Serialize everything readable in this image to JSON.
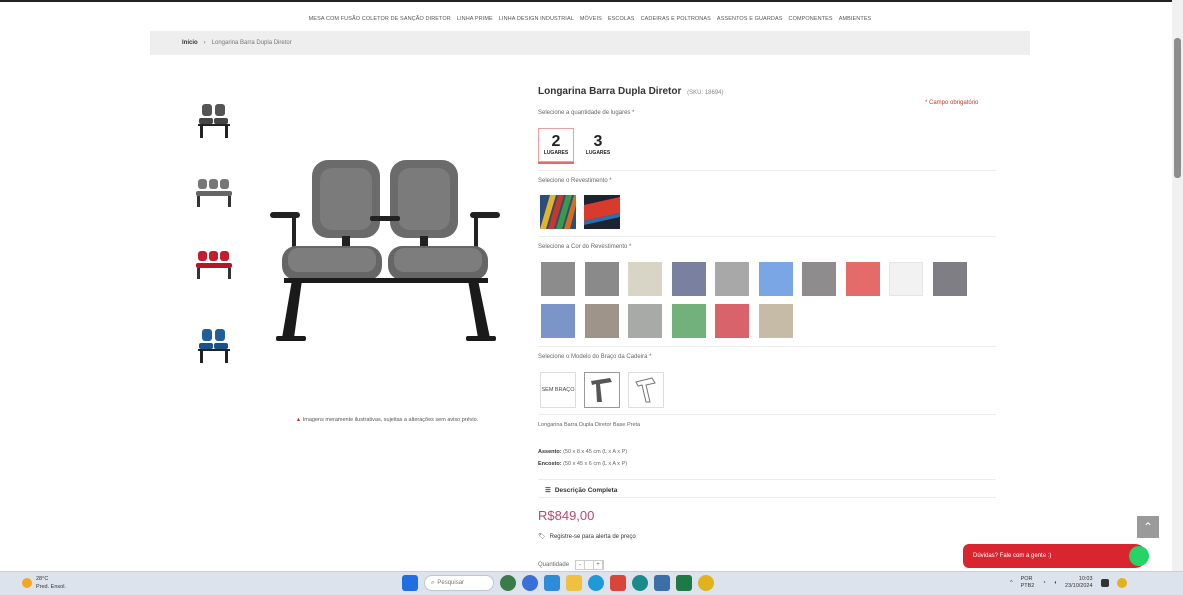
{
  "nav": {
    "items": [
      "MESA COM FUSÃO COLETOR DE SANÇÃO DIRETOR",
      "LINHA PRIME",
      "LINHA DESIGN INDUSTRIAL",
      "MÓVEIS",
      "ESCOLAS",
      "CADEIRAS E POLTRONAS",
      "ASSENTOS E GUARDAS",
      "COMPONENTES",
      "AMBIENTES"
    ]
  },
  "breadcrumb": {
    "home": "Início",
    "sep": "›",
    "current": "Longarina Barra Dupla Diretor"
  },
  "product": {
    "title": "Longarina Barra Dupla Diretor",
    "code": "(SKU: 18694)",
    "required_note": "* Campo obrigatório",
    "qty_label": "Selecione a quantidade de lugares *",
    "qty_options": [
      {
        "n": "2",
        "w": "LUGARES"
      },
      {
        "n": "3",
        "w": "LUGARES"
      }
    ],
    "fabric_label": "Selecione o Revestimento *",
    "color_label": "Selecione a Cor do Revestimento *",
    "colors": [
      "#8c8c8c",
      "#8a8a8a",
      "#d8d4c6",
      "#7a80a0",
      "#a8a8a8",
      "#7aa6e6",
      "#8e8c8c",
      "#e56b6b",
      "#f2f2f2",
      "#7e7e84",
      "#7c95c9",
      "#9e948a",
      "#a8aaa8",
      "#72b07c",
      "#d8636a",
      "#c6bba6"
    ],
    "arm_label": "Selecione o Modelo do Braço da Cadeira *",
    "arm_none": "SEM BRAÇO",
    "summary": "Longarina Barra Dupla Diretor Base Preta",
    "seat_label": "Assento:",
    "seat_value": "(50 x 8 x 45 cm (L x A x P)",
    "back_label": "Encosto:",
    "back_value": "(50 x 45 x 6 cm (L x A x P)",
    "full_description": "Descrição Completa",
    "price": "R$849,00",
    "price_alert": "Registre-se para alerta de preço",
    "quantity_label": "Quantidade",
    "image_notice_warn": "▲",
    "image_notice": "Imagens meramente ilustrativas, sujeitas a alterações sem aviso prévio."
  },
  "chat": {
    "text": "Dúvidas? Fale com a gente :)"
  },
  "taskbar": {
    "temp": "28°C",
    "weather": "Pred. Ensol.",
    "search_placeholder": "Pesquisar",
    "lang": "POR",
    "lang2": "PTB2",
    "time": "10:03",
    "date": "23/10/2024"
  }
}
